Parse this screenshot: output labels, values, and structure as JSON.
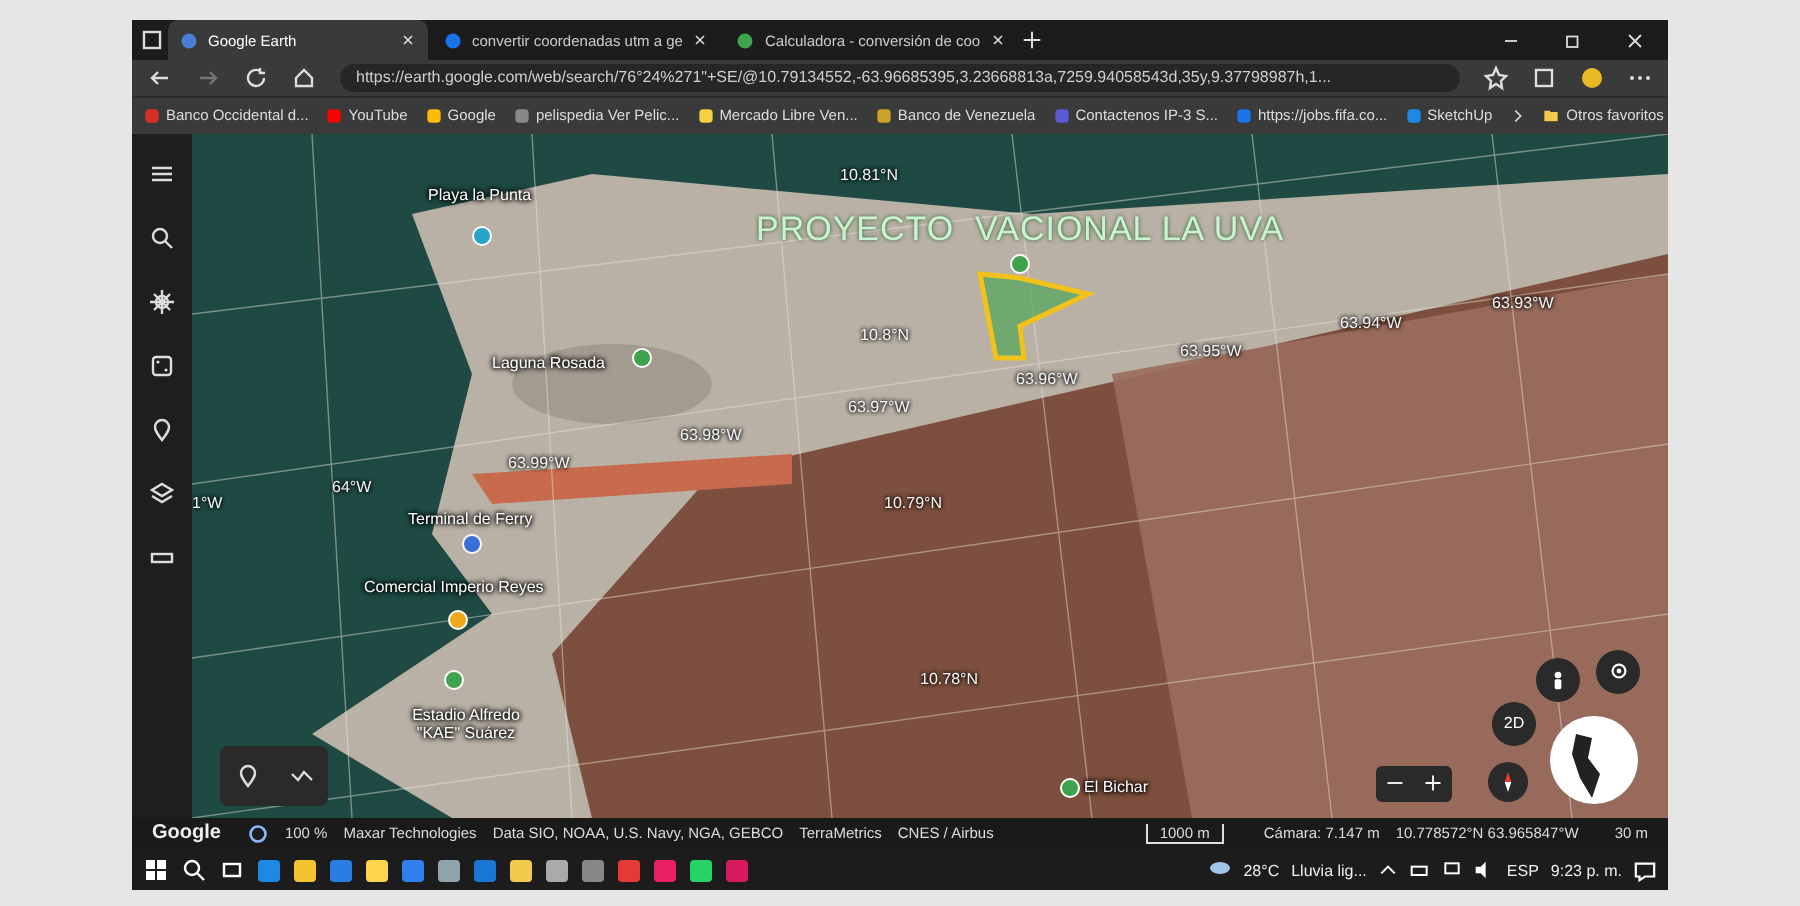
{
  "browser": {
    "tabs": [
      {
        "title": "Google Earth",
        "selected": true
      },
      {
        "title": "convertir coordenadas utm a ge",
        "selected": false
      },
      {
        "title": "Calculadora - conversión de coo",
        "selected": false
      }
    ],
    "url": "https://earth.google.com/web/search/76°24%271\"+SE/@10.79134552,-63.96685395,3.23668813a,7259.94058543d,35y,9.37798987h,1...",
    "bookmarks": [
      "Banco Occidental d...",
      "YouTube",
      "Google",
      "pelispedia Ver Pelic...",
      "Mercado Libre Ven...",
      "Banco de Venezuela",
      "Contactenos IP-3 S...",
      "https://jobs.fifa.co...",
      "SketchUp"
    ],
    "other_bookmarks": "Otros favoritos"
  },
  "map": {
    "project_label": "PROYECTO  VACIONAL LA UVA",
    "places": [
      {
        "name": "Playa la Punta",
        "color": "#29a3c9"
      },
      {
        "name": "Laguna Rosada",
        "color": "#3fa34d"
      },
      {
        "name": "Terminal de Ferry",
        "color": "#3b6fd6"
      },
      {
        "name": "Comercial Imperio Reyes",
        "color": "#f0a81e"
      },
      {
        "name": "Estadio Alfredo \"KAE\" Suárez",
        "color": "#3fa34d"
      },
      {
        "name": "El Bichar",
        "color": "#3fa34d"
      }
    ],
    "grid_labels": [
      "10.81°N",
      "10.8°N",
      "10.79°N",
      "10.78°N",
      "63.93°W",
      "63.94°W",
      "63.95°W",
      "63.96°W",
      "63.97°W",
      "63.98°W",
      "63.99°W",
      "64°W",
      "1°W"
    ],
    "view_mode": "2D"
  },
  "status_bar": {
    "logo": "Google",
    "loading": "100 %",
    "attributions": [
      "Maxar Technologies",
      "Data SIO, NOAA, U.S. Navy, NGA, GEBCO",
      "TerraMetrics",
      "CNES / Airbus"
    ],
    "scale": "1000 m",
    "camera": "Cámara: 7.147 m",
    "coordinates": "10.778572°N 63.965847°W",
    "elevation": "30 m"
  },
  "taskbar": {
    "temperature": "28°C",
    "weather": "Lluvia lig...",
    "language": "ESP",
    "time": "9:23 p. m."
  }
}
